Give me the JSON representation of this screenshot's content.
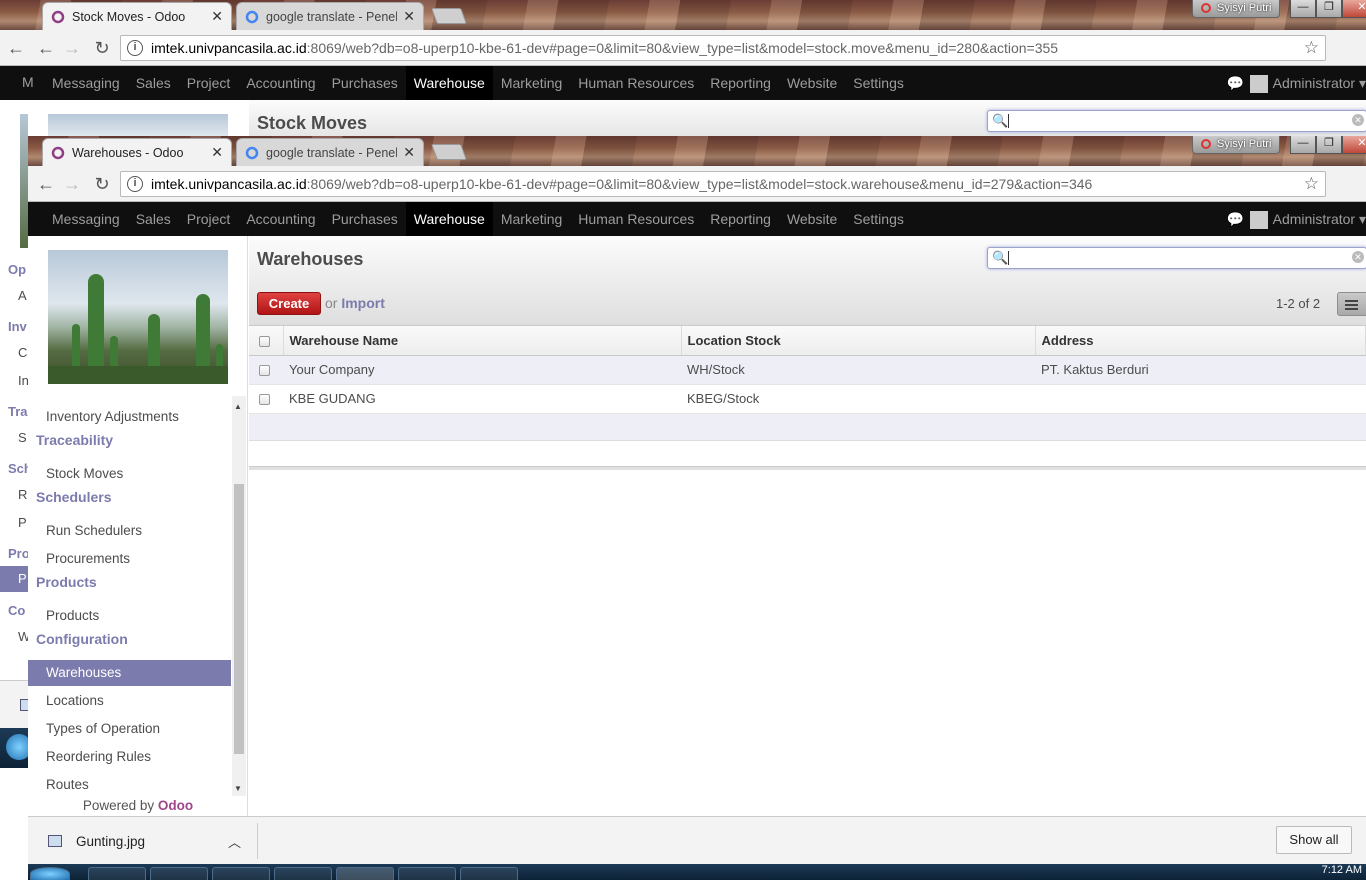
{
  "back_window": {
    "tabs": [
      {
        "title": "Stock Moves - Odoo",
        "close": "✕"
      },
      {
        "title": "google translate - Penelu",
        "close": "✕"
      }
    ],
    "profile": "Syisyi Putri",
    "url_host": "imtek.univpancasila.ac.id",
    "url_rest": ":8069/web?db=o8-uperp10-kbe-61-dev#page=0&limit=80&view_type=list&model=stock.move&menu_id=280&action=355",
    "page_title": "Stock Moves",
    "left_fragments": [
      "M",
      "Op",
      "A",
      "Inv",
      "C",
      "In",
      "Tra",
      "S",
      "Sch",
      "R",
      "P",
      "Pro",
      "P",
      "Co",
      "W"
    ]
  },
  "front_window": {
    "tabs": [
      {
        "title": "Warehouses - Odoo",
        "close": "✕"
      },
      {
        "title": "google translate - Penelu",
        "close": "✕"
      }
    ],
    "profile": "Syisyi Putri",
    "url_host": "imtek.univpancasila.ac.id",
    "url_rest": ":8069/web?db=o8-uperp10-kbe-61-dev#page=0&limit=80&view_type=list&model=stock.warehouse&menu_id=279&action=346"
  },
  "topnav": {
    "items": [
      "Messaging",
      "Sales",
      "Project",
      "Accounting",
      "Purchases",
      "Warehouse",
      "Marketing",
      "Human Resources",
      "Reporting",
      "Website",
      "Settings"
    ],
    "active": "Warehouse",
    "user": "Administrator"
  },
  "sidebar": {
    "items": [
      {
        "type": "item",
        "label": "Inventory Adjustments"
      },
      {
        "type": "head",
        "label": "Traceability"
      },
      {
        "type": "item",
        "label": "Stock Moves"
      },
      {
        "type": "head",
        "label": "Schedulers"
      },
      {
        "type": "item",
        "label": "Run Schedulers"
      },
      {
        "type": "item",
        "label": "Procurements"
      },
      {
        "type": "head",
        "label": "Products"
      },
      {
        "type": "item",
        "label": "Products"
      },
      {
        "type": "head",
        "label": "Configuration"
      },
      {
        "type": "item",
        "label": "Warehouses",
        "active": true
      },
      {
        "type": "item",
        "label": "Locations"
      },
      {
        "type": "item",
        "label": "Types of Operation"
      },
      {
        "type": "item",
        "label": "Reordering Rules"
      },
      {
        "type": "item",
        "label": "Routes"
      }
    ],
    "powered_by": "Powered by",
    "powered_brand": "Odoo"
  },
  "main": {
    "title": "Warehouses",
    "create_label": "Create",
    "or_label": "or",
    "import_label": "Import",
    "pager": "1-2 of 2",
    "columns": [
      "Warehouse Name",
      "Location Stock",
      "Address"
    ],
    "rows": [
      [
        "Your Company",
        "WH/Stock",
        "PT. Kaktus Berduri"
      ],
      [
        "KBE GUDANG",
        "KBEG/Stock",
        ""
      ]
    ]
  },
  "download_bar": {
    "file": "Gunting.jpg",
    "show_all": "Show all"
  },
  "taskbar": {
    "clock": "7:12 AM"
  }
}
